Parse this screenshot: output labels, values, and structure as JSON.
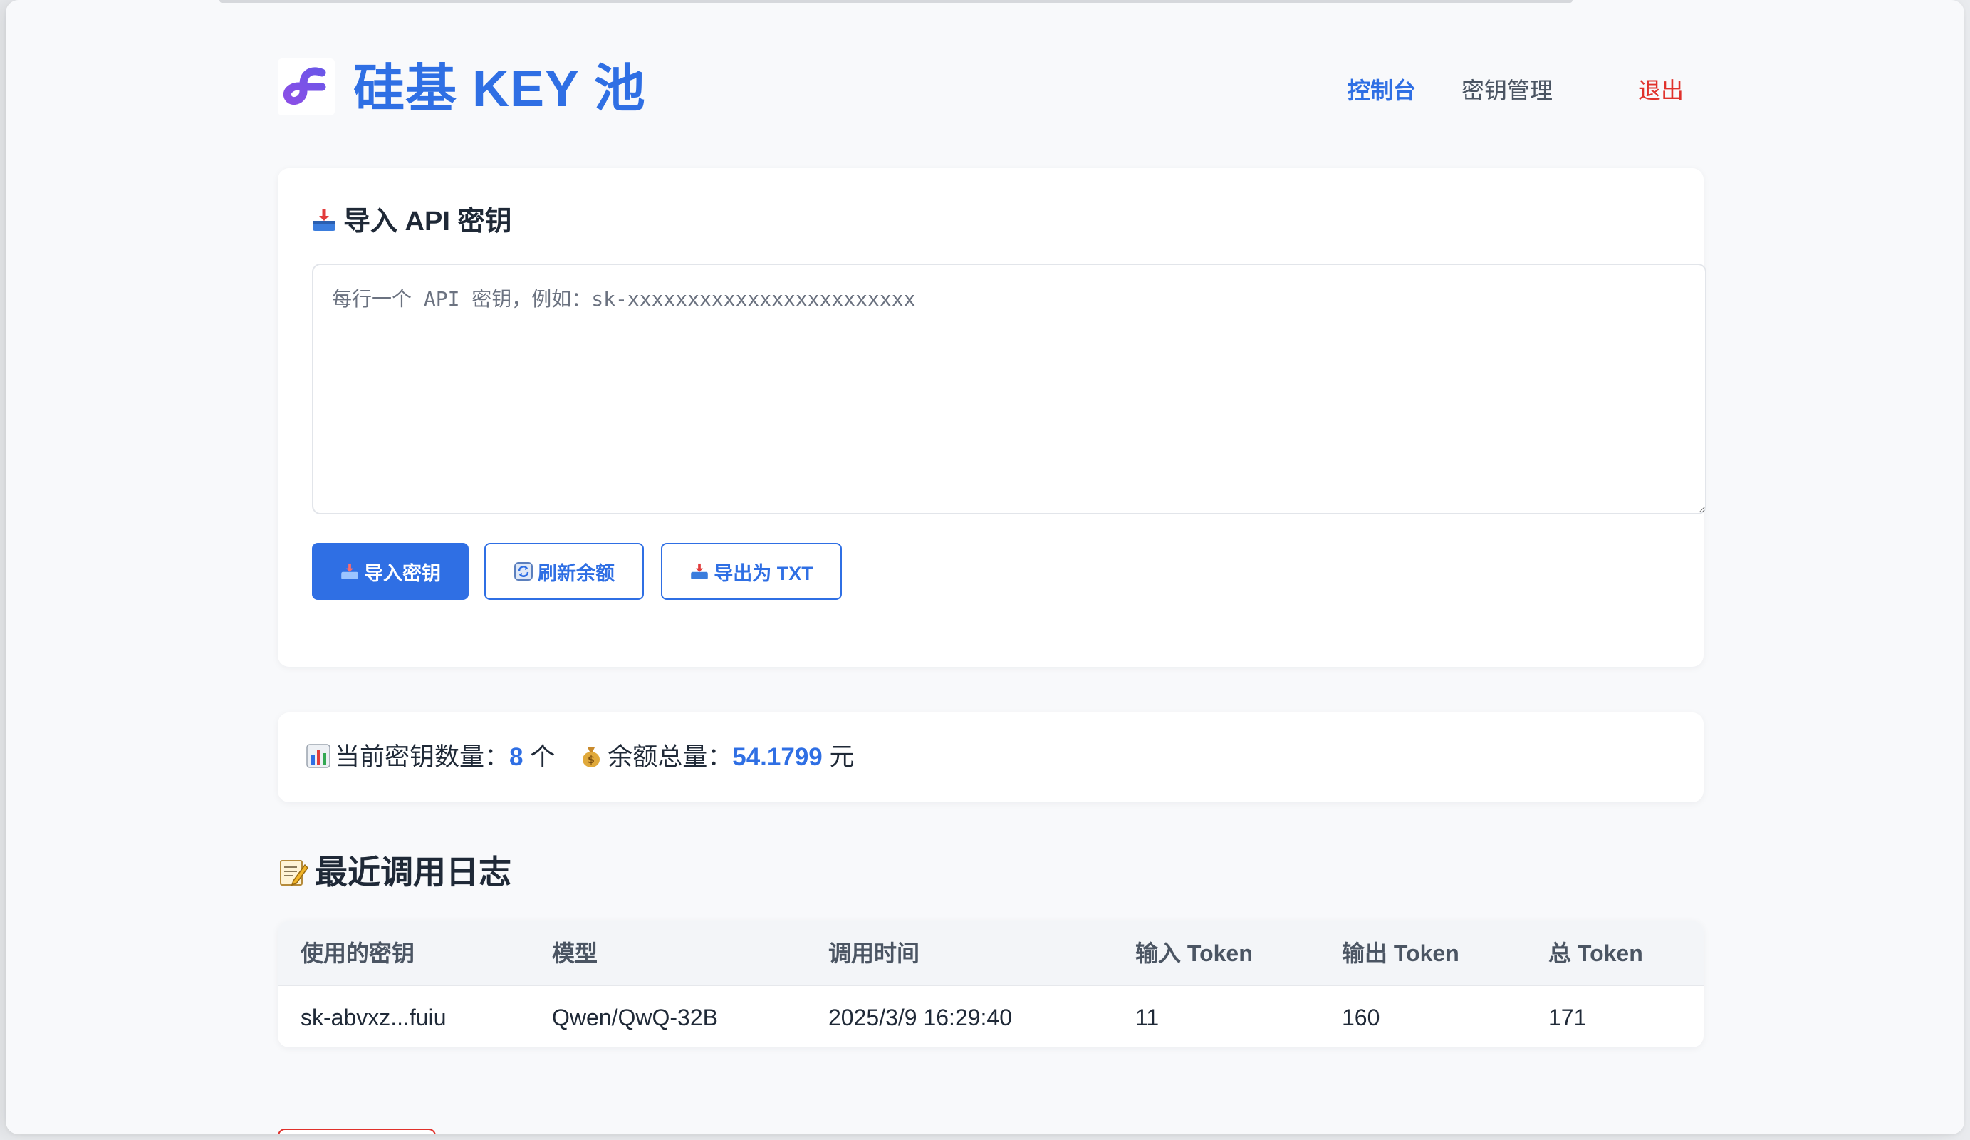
{
  "app": {
    "brand": "硅基 KEY 池",
    "logo_icon": "siliconflow-logo-icon",
    "accent_color": "#2f6fe4",
    "danger_color": "#e0312b"
  },
  "nav": {
    "console": "控制台",
    "key_management": "密钥管理",
    "logout": "退出"
  },
  "import_section": {
    "title": "导入 API 密钥",
    "title_icon": "inbox-tray-icon",
    "textarea_placeholder": "每行一个 API 密钥，例如：sk-xxxxxxxxxxxxxxxxxxxxxxxx",
    "textarea_value": "",
    "buttons": {
      "import": "导入密钥",
      "refresh": "刷新余额",
      "export": "导出为 TXT"
    }
  },
  "stats": {
    "key_count_label": "当前密钥数量：",
    "key_count": "8",
    "key_count_unit": " 个",
    "balance_label": "余额总量：",
    "balance_total": "54.1799",
    "balance_unit": " 元"
  },
  "logs": {
    "title": "最近调用日志",
    "title_icon": "memo-icon",
    "columns": [
      "使用的密钥",
      "模型",
      "调用时间",
      "输入 Token",
      "输出 Token",
      "总 Token"
    ],
    "rows": [
      {
        "key": "sk-abvxz...fuiu",
        "model": "Qwen/QwQ-32B",
        "time": "2025/3/9 16:29:40",
        "input_tokens": "11",
        "output_tokens": "160",
        "total_tokens": "171"
      }
    ]
  }
}
